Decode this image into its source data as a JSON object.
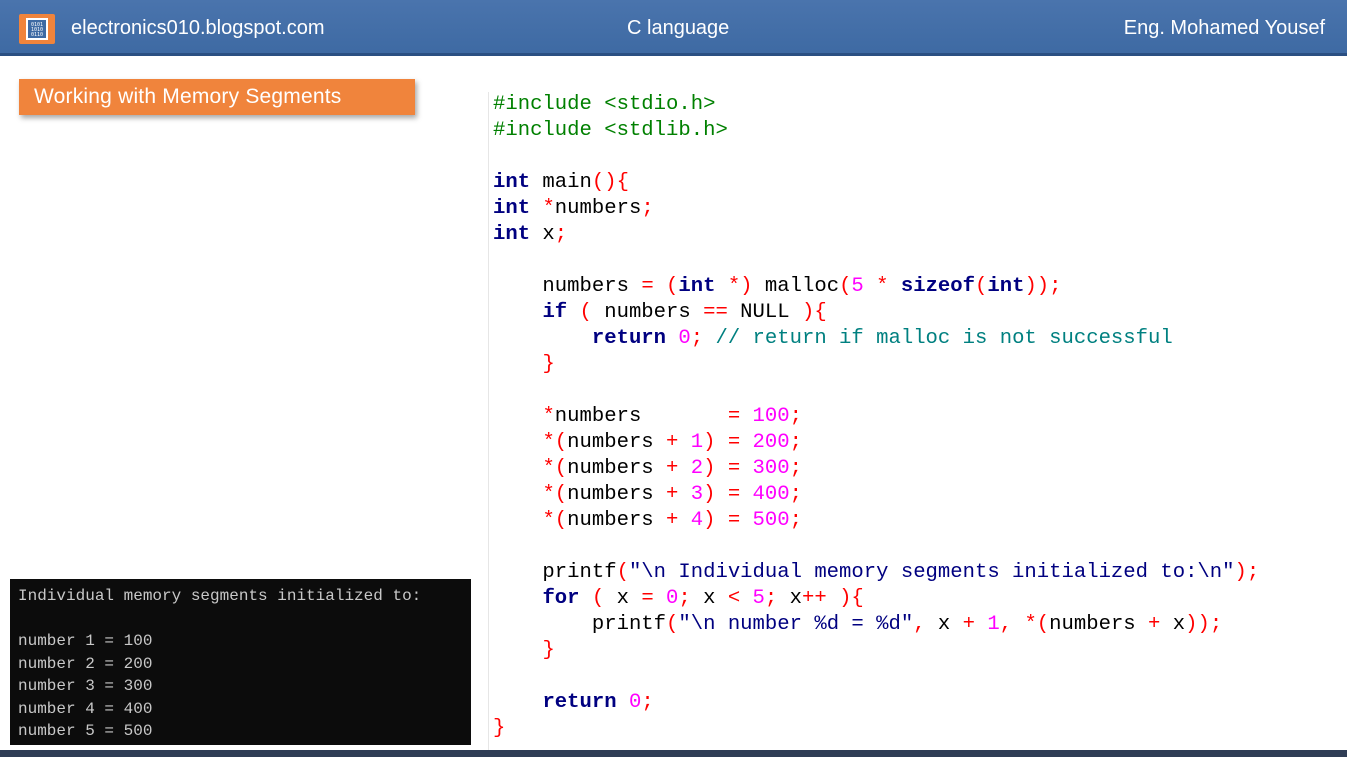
{
  "header": {
    "site": "electronics010.blogspot.com",
    "title": "C language",
    "author": "Eng. Mohamed Yousef",
    "logo_icon": "chip-binary-icon"
  },
  "badge": {
    "label": "Working with Memory Segments"
  },
  "colors": {
    "header_bg": "#3e6aa3",
    "badge_bg": "#f0843c",
    "console_bg": "#0c0c0c",
    "keyword": "#000080",
    "number": "#ff00ff",
    "operator": "#ff0000",
    "comment": "#008080"
  },
  "code": {
    "include1": "#include <stdio.h>",
    "include2": "#include <stdlib.h>",
    "malloc_comment": "// return if malloc is not successful",
    "printf1_text": "\"\\n Individual memory segments initialized to:\\n\"",
    "printf2_text": "\"\\n number %d = %d\""
  },
  "console": {
    "lines": [
      "Individual memory segments initialized to:",
      "",
      "number 1 = 100",
      "number 2 = 200",
      "number 3 = 300",
      "number 4 = 400",
      "number 5 = 500"
    ]
  }
}
